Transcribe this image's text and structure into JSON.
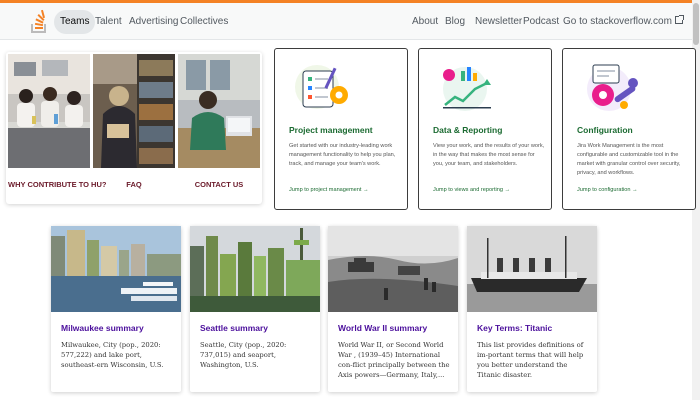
{
  "nav": {
    "logo_icon": "stackoverflow-logo-icon",
    "left_links": [
      "Teams",
      "Talent",
      "Advertising",
      "Collectives"
    ],
    "right_links": [
      "About",
      "Blog",
      "Newsletter",
      "Podcast"
    ],
    "external_link": "Go to stackoverflow.com",
    "external_icon": "external-link-icon"
  },
  "photo_tiles": [
    {
      "label": "WHY CONTRIBUTE TO HU?"
    },
    {
      "label": "FAQ"
    },
    {
      "label": "CONTACT US"
    }
  ],
  "product_cards": [
    {
      "title": "Project management",
      "description": "Get started with our industry-leading work management functionality to help you plan, track, and manage your team's work.",
      "link": "Jump to project management →",
      "icon": "task-list-gear-icon"
    },
    {
      "title": "Data & Reporting",
      "description": "View your work, and the results of your work, in the way that makes the most sense for you, your team, and stakeholders.",
      "link": "Jump to views and reporting →",
      "icon": "chart-growth-icon"
    },
    {
      "title": "Configuration",
      "description": "Jira Work Management is the most configurable and customizable tool in the market with granular control over security, privacy, and workflows.",
      "link": "Jump to configuration →",
      "icon": "settings-wrench-icon"
    }
  ],
  "article_cards": [
    {
      "title": "Milwaukee summary",
      "description": "Milwaukee, City (pop., 2020: 577,222) and lake port, southeast-ern Wisconsin, U.S."
    },
    {
      "title": "Seattle summary",
      "description": "Seattle, City (pop., 2020: 737,015) and seaport, Washington, U.S."
    },
    {
      "title": "World War II summary",
      "description": "World War II, or Second World War , (1939–45) International con-flict principally between the Axis powers—Germany, Italy,..."
    },
    {
      "title": "Key Terms: Titanic",
      "description": "This list provides definitions of im-portant terms that will help you better understand the Titanic disaster."
    }
  ],
  "colors": {
    "accent_orange": "#f48225",
    "product_green": "#1c6b32",
    "article_purple": "#4b0f9c",
    "tile_label": "#6b1a2a"
  }
}
